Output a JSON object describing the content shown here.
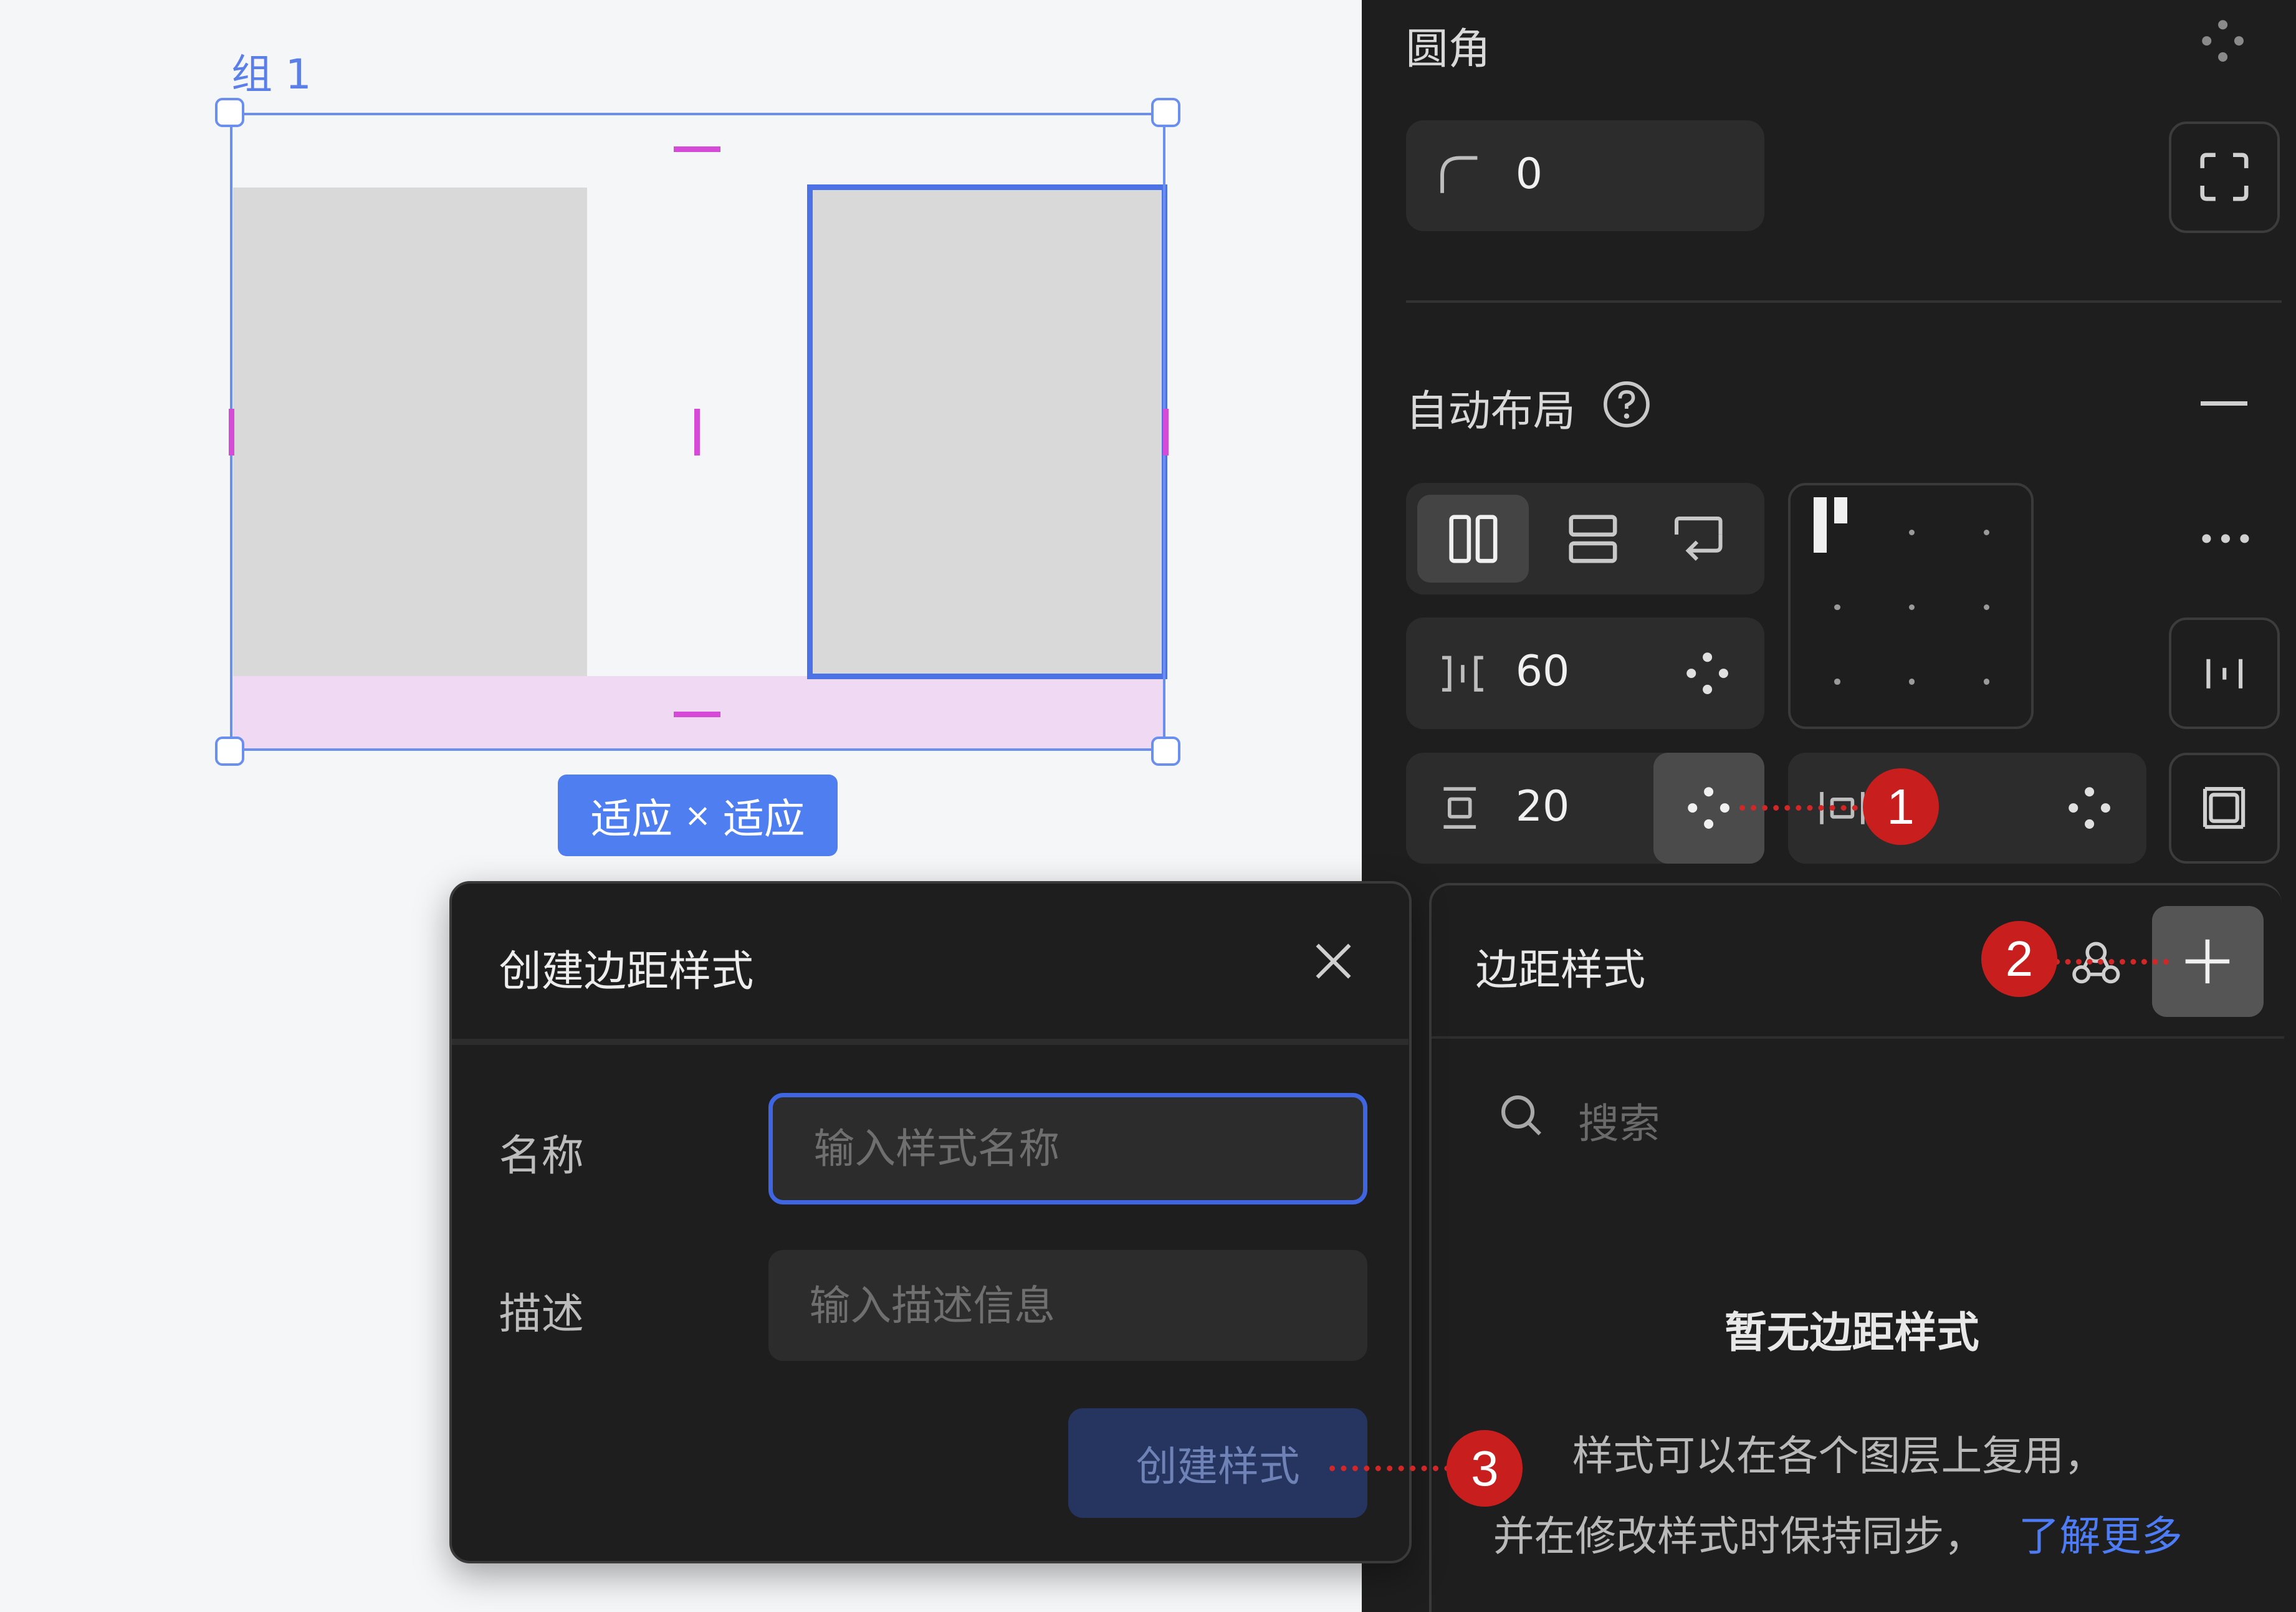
{
  "canvas": {
    "frame_label": "组 1",
    "size_pill": {
      "width_mode": "适应",
      "times": "×",
      "height_mode": "适应"
    }
  },
  "panel": {
    "corner_radius": {
      "title": "圆角",
      "value": "0"
    },
    "auto_layout": {
      "title": "自动布局",
      "gap_value": "60",
      "padding_value": "20"
    }
  },
  "style_popup": {
    "title": "边距样式",
    "search_placeholder": "搜索",
    "empty_title": "暂无边距样式",
    "empty_line1": "样式可以在各个图层上复用，",
    "empty_line2": "并在修改样式时保持同步，",
    "learn_more": "了解更多"
  },
  "dialog": {
    "title": "创建边距样式",
    "name_label": "名称",
    "name_placeholder": "输入样式名称",
    "desc_label": "描述",
    "desc_placeholder": "输入描述信息",
    "create_button": "创建样式"
  },
  "steps": [
    "1",
    "2",
    "3"
  ],
  "colors": {
    "accent": "#4f7ef0",
    "selection": "#6b8fef",
    "padding_marker": "#d64ad8",
    "step_badge": "#c81e1e"
  }
}
